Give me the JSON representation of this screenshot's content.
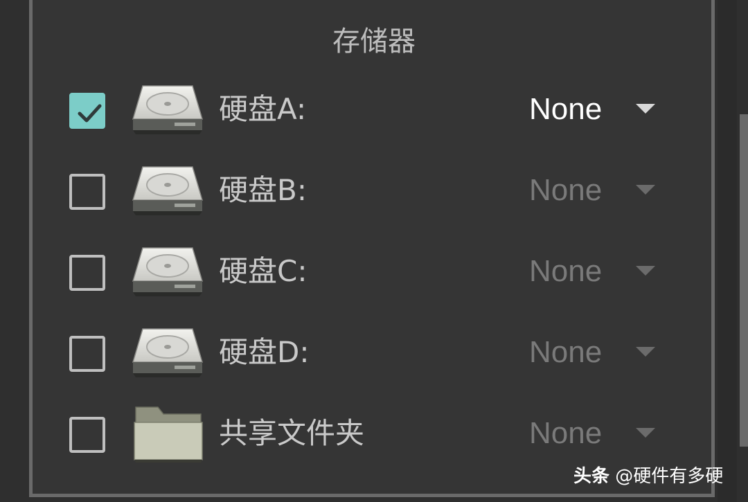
{
  "panel": {
    "title": "存储器"
  },
  "storage_items": [
    {
      "label": "硬盘A:",
      "checked": true,
      "icon": "hard-disk-icon",
      "value": "None",
      "enabled": true
    },
    {
      "label": "硬盘B:",
      "checked": false,
      "icon": "hard-disk-icon",
      "value": "None",
      "enabled": false
    },
    {
      "label": "硬盘C:",
      "checked": false,
      "icon": "hard-disk-icon",
      "value": "None",
      "enabled": false
    },
    {
      "label": "硬盘D:",
      "checked": false,
      "icon": "hard-disk-icon",
      "value": "None",
      "enabled": false
    },
    {
      "label": "共享文件夹",
      "checked": false,
      "icon": "folder-icon",
      "value": "None",
      "enabled": false
    }
  ],
  "watermark": {
    "brand": "头条",
    "handle": "@硬件有多硬"
  },
  "colors": {
    "background": "#353535",
    "checkbox_accent": "#7ccdc8",
    "text_enabled": "#ffffff",
    "text_disabled": "#7a7a7a"
  }
}
